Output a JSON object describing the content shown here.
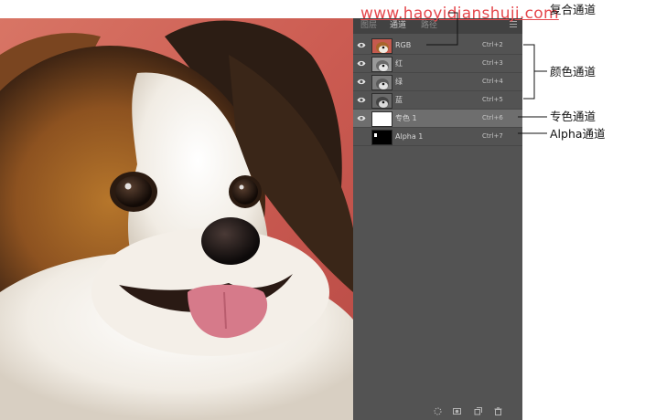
{
  "panel": {
    "tabs": [
      {
        "label": "图层"
      },
      {
        "label": "通道"
      },
      {
        "label": "路径"
      }
    ],
    "channels": [
      {
        "label": "RGB",
        "shortcut": "Ctrl+2",
        "visible": true,
        "selected": false
      },
      {
        "label": "红",
        "shortcut": "Ctrl+3",
        "visible": true,
        "selected": false
      },
      {
        "label": "绿",
        "shortcut": "Ctrl+4",
        "visible": true,
        "selected": false
      },
      {
        "label": "蓝",
        "shortcut": "Ctrl+5",
        "visible": true,
        "selected": false
      },
      {
        "label": "专色 1",
        "shortcut": "Ctrl+6",
        "visible": true,
        "selected": true
      },
      {
        "label": "Alpha 1",
        "shortcut": "Ctrl+7",
        "visible": false,
        "selected": false
      }
    ],
    "footer_icons": [
      "load-selection-icon",
      "save-selection-icon",
      "new-channel-icon",
      "delete-icon"
    ]
  },
  "watermark": "www.haoyidianshuji.com",
  "annotations": {
    "composite": "复合通道",
    "color": "颜色通道",
    "spot": "专色通道",
    "alpha": "Alpha通道"
  },
  "colors": {
    "panel_bg": "#535353",
    "selected_row": "#6e6e6e",
    "watermark": "#e5484d"
  }
}
